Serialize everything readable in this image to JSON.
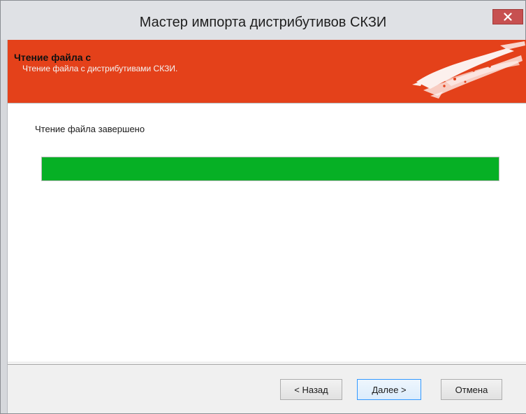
{
  "window": {
    "title": "Мастер импорта дистрибутивов СКЗИ"
  },
  "banner": {
    "title": "Чтение файла с",
    "subtitle": "Чтение файла с дистрибутивами СКЗИ.",
    "logo_icon": "brush-stroke-logo"
  },
  "main": {
    "status": "Чтение файла завершено",
    "progress_percent": 100,
    "progress_color": "#06b025"
  },
  "buttons": {
    "back": "< Назад",
    "next": "Далее >",
    "cancel": "Отмена"
  },
  "colors": {
    "banner": "#e4411a",
    "close": "#c75050"
  }
}
